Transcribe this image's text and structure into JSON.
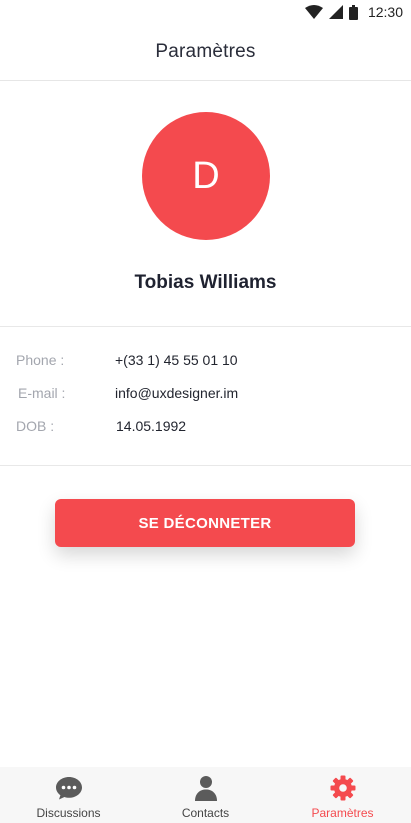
{
  "status_bar": {
    "time": "12:30"
  },
  "header": {
    "title": "Paramètres"
  },
  "profile": {
    "initial": "D",
    "name": "Tobias Williams",
    "avatar_color": "#f44a4e"
  },
  "info": {
    "phone": {
      "label": "Phone :",
      "value": "+(33 1) 45 55 01 10"
    },
    "email": {
      "label": "E-mail :",
      "value": "info@uxdesigner.im"
    },
    "dob": {
      "label": "DOB :",
      "value": "14.05.1992"
    }
  },
  "logout_label": "SE DÉCONNETER",
  "bottom_nav": {
    "items": [
      {
        "label": "Discussions",
        "icon": "chat-bubble-icon",
        "active": false
      },
      {
        "label": "Contacts",
        "icon": "person-icon",
        "active": false
      },
      {
        "label": "Paramètres",
        "icon": "gear-icon",
        "active": true
      }
    ]
  },
  "colors": {
    "accent": "#f44a4e",
    "nav_background": "#f7f7f7",
    "icon_gray": "#5b5b5b"
  }
}
